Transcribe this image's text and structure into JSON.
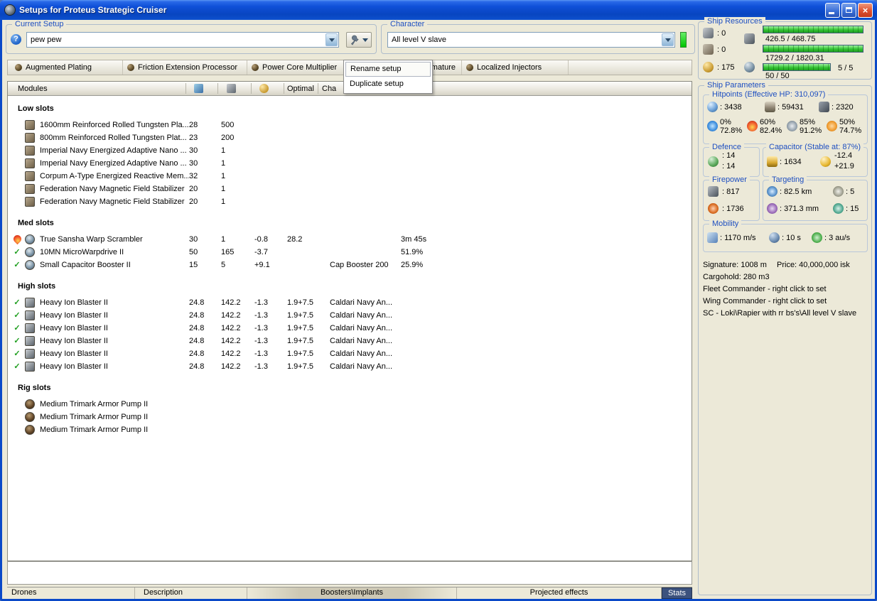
{
  "window": {
    "title": "Setups for Proteus Strategic Cruiser"
  },
  "icons": {
    "help": "?",
    "close": "×",
    "check": "✓"
  },
  "colors": {
    "titlebar_blue": "#0a49c8",
    "group_label_blue": "#1e4fc1",
    "resource_bar_green": "#35c435",
    "character_indicator_green": "#00d400",
    "stats_tab_dark": "#3c527e"
  },
  "current_setup": {
    "label": "Current Setup",
    "value": "pew pew"
  },
  "character": {
    "label": "Character",
    "value": "All level V slave"
  },
  "ship_resources": {
    "label": "Ship Resources",
    "turret_hardpoints": ": 0",
    "launcher_hardpoints": ": 0",
    "calibration": ": 175",
    "cpu": "426.5 / 468.75",
    "powergrid": "1729.2 / 1820.31",
    "drone_bandwidth": "50 / 50",
    "upgrade_slots": "5 / 5"
  },
  "subsystems": [
    {
      "label": "Augmented Plating"
    },
    {
      "label": "Friction Extension Processor"
    },
    {
      "label": "Power Core Multiplier"
    },
    {
      "label": "mature"
    },
    {
      "label": "Localized Injectors"
    }
  ],
  "context_menu": {
    "items": [
      "Rename setup",
      "Duplicate setup"
    ]
  },
  "modules_table": {
    "header": {
      "modules": "Modules",
      "optimal": "Optimal",
      "charge": "Cha"
    },
    "sections": [
      {
        "title": "Low slots",
        "icon": "mi-plate",
        "rows": [
          {
            "status": "",
            "name": "1600mm Reinforced Rolled Tungsten Pla...",
            "c1": "28",
            "c2": "500"
          },
          {
            "status": "",
            "name": "800mm Reinforced Rolled Tungsten Plat...",
            "c1": "23",
            "c2": "200"
          },
          {
            "status": "",
            "name": "Imperial Navy Energized Adaptive Nano ...",
            "c1": "30",
            "c2": "1"
          },
          {
            "status": "",
            "name": "Imperial Navy Energized Adaptive Nano ...",
            "c1": "30",
            "c2": "1"
          },
          {
            "status": "",
            "name": "Corpum A-Type Energized Reactive Mem...",
            "c1": "32",
            "c2": "1"
          },
          {
            "status": "",
            "name": "Federation Navy Magnetic Field Stabilizer",
            "c1": "20",
            "c2": "1"
          },
          {
            "status": "",
            "name": "Federation Navy Magnetic Field Stabilizer",
            "c1": "20",
            "c2": "1"
          }
        ]
      },
      {
        "title": "Med slots",
        "icon": "mi-orb",
        "rows": [
          {
            "status": "fire",
            "name": "True Sansha Warp Scrambler",
            "c1": "30",
            "c2": "1",
            "c3": "-0.8",
            "c4": "28.2",
            "extra": "3m 45s"
          },
          {
            "status": "ok",
            "name": "10MN MicroWarpdrive II",
            "c1": "50",
            "c2": "165",
            "c3": "-3.7",
            "extra": "51.9%"
          },
          {
            "status": "ok",
            "name": "Small Capacitor Booster II",
            "c1": "15",
            "c2": "5",
            "c3": "+9.1",
            "charge": "Cap Booster 200",
            "extra": "25.9%"
          }
        ]
      },
      {
        "title": "High slots",
        "icon": "mi-turret",
        "rows": [
          {
            "status": "ok",
            "name": "Heavy Ion Blaster II",
            "c1": "24.8",
            "c2": "142.2",
            "c3": "-1.3",
            "c4": "1.9+7.5",
            "charge": "Caldari Navy An..."
          },
          {
            "status": "ok",
            "name": "Heavy Ion Blaster II",
            "c1": "24.8",
            "c2": "142.2",
            "c3": "-1.3",
            "c4": "1.9+7.5",
            "charge": "Caldari Navy An..."
          },
          {
            "status": "ok",
            "name": "Heavy Ion Blaster II",
            "c1": "24.8",
            "c2": "142.2",
            "c3": "-1.3",
            "c4": "1.9+7.5",
            "charge": "Caldari Navy An..."
          },
          {
            "status": "ok",
            "name": "Heavy Ion Blaster II",
            "c1": "24.8",
            "c2": "142.2",
            "c3": "-1.3",
            "c4": "1.9+7.5",
            "charge": "Caldari Navy An..."
          },
          {
            "status": "ok",
            "name": "Heavy Ion Blaster II",
            "c1": "24.8",
            "c2": "142.2",
            "c3": "-1.3",
            "c4": "1.9+7.5",
            "charge": "Caldari Navy An..."
          },
          {
            "status": "ok",
            "name": "Heavy Ion Blaster II",
            "c1": "24.8",
            "c2": "142.2",
            "c3": "-1.3",
            "c4": "1.9+7.5",
            "charge": "Caldari Navy An..."
          }
        ]
      },
      {
        "title": "Rig slots",
        "icon": "mi-rig",
        "rows": [
          {
            "status": "",
            "name": "Medium Trimark Armor Pump II"
          },
          {
            "status": "",
            "name": "Medium Trimark Armor Pump II"
          },
          {
            "status": "",
            "name": "Medium Trimark Armor Pump II"
          }
        ]
      }
    ]
  },
  "ship_parameters": {
    "label": "Ship Parameters",
    "hitpoints": {
      "label": "Hitpoints (Effective HP: 310,097)",
      "shield": ": 3438",
      "armor": ": 59431",
      "structure": ": 2320",
      "resists": [
        {
          "type": "em",
          "shield": "0%",
          "armor": "72.8%"
        },
        {
          "type": "thermal",
          "shield": "60%",
          "armor": "82.4%"
        },
        {
          "type": "kinetic",
          "shield": "85%",
          "armor": "91.2%"
        },
        {
          "type": "explosive",
          "shield": "50%",
          "armor": "74.7%"
        }
      ]
    },
    "defence": {
      "label": "Defence",
      "value1": ": 14",
      "value2": ": 14"
    },
    "capacitor": {
      "label": "Capacitor (Stable at: 87%)",
      "amount": ": 1634",
      "drain": "-12.4",
      "recharge": "+21.9"
    },
    "firepower": {
      "label": "Firepower",
      "dps": ": 817",
      "volley": ": 1736"
    },
    "targeting": {
      "label": "Targeting",
      "range": ": 82.5 km",
      "max_targets": ": 5",
      "scan_resolution": ": 371.3 mm",
      "sensor_strength": ": 15"
    },
    "mobility": {
      "label": "Mobility",
      "speed": ": 1170 m/s",
      "align_time": ": 10 s",
      "warp_speed": ": 3 au/s"
    },
    "info": {
      "signature": "Signature: 1008 m",
      "price": "Price: 40,000,000 isk",
      "cargohold": "Cargohold: 280 m3",
      "fleet_commander": "Fleet Commander - right click to set",
      "wing_commander": "Wing Commander - right click to set",
      "setup_path": "SC - Loki\\Rapier with rr bs's\\All level V slave"
    }
  },
  "bottom_tabs": [
    "Drones",
    "Description",
    "Boosters\\Implants",
    "Projected effects",
    "Stats"
  ]
}
